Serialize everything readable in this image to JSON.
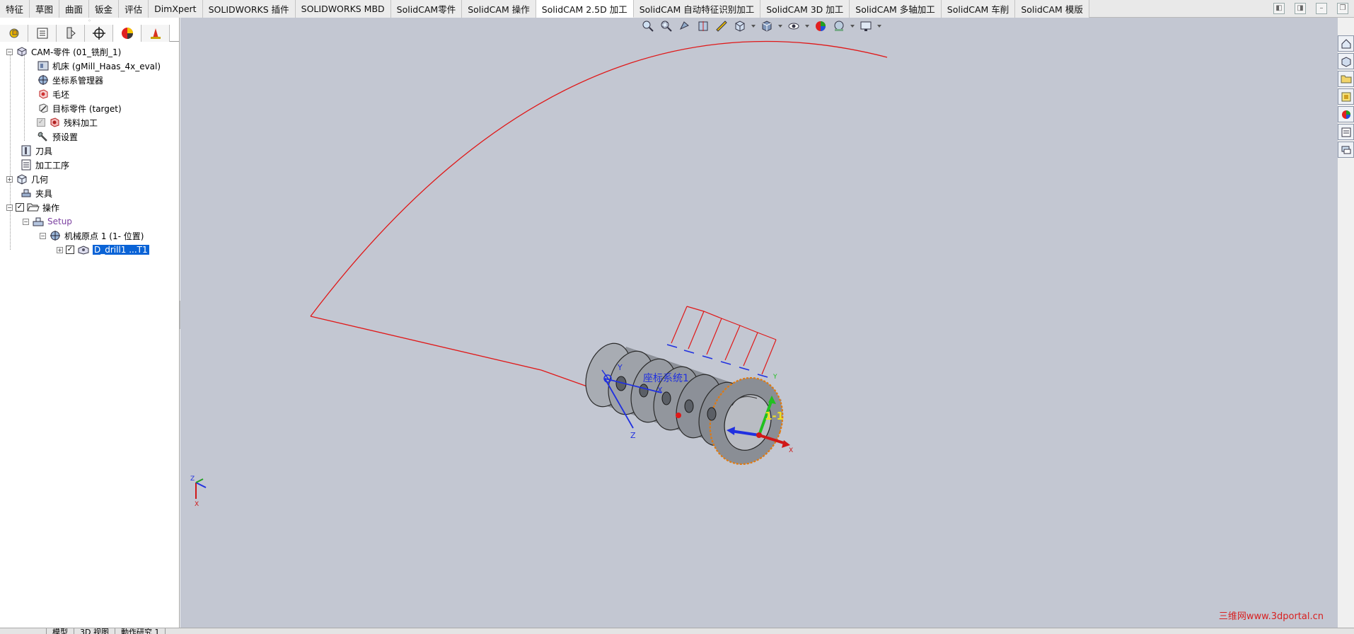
{
  "tabs": [
    "特征",
    "草图",
    "曲面",
    "钣金",
    "评估",
    "DimXpert",
    "SOLIDWORKS 插件",
    "SOLIDWORKS MBD",
    "SolidCAM零件",
    "SolidCAM 操作",
    "SolidCAM 2.5D 加工",
    "SolidCAM 自动特征识别加工",
    "SolidCAM 3D 加工",
    "SolidCAM 多轴加工",
    "SolidCAM 车削",
    "SolidCAM 模版"
  ],
  "active_tab_index": 10,
  "panel_tabs": [
    "feature-manager-icon",
    "property-manager-icon",
    "configuration-manager-icon",
    "dimxpert-icon",
    "display-manager-icon",
    "solidcam-manager-icon"
  ],
  "tree": {
    "root": "CAM-零件 (01_铣削_1)",
    "machine": "机床 (gMill_Haas_4x_eval)",
    "coord_manager": "坐标系管理器",
    "stock": "毛坯",
    "target": "目标零件 (target)",
    "rest": "残料加工",
    "presets": "预设置",
    "tools": "刀具",
    "process": "加工工序",
    "geometry": "几何",
    "fixture": "夹具",
    "operations": "操作",
    "setup": "Setup",
    "machine_origin": "机械原点 1 (1- 位置)",
    "operation_item": "D_drill1 ...T1"
  },
  "viewport": {
    "coord_label": "座标系统1",
    "axis_x": "X",
    "axis_y": "Y",
    "axis_z": "Z",
    "origin_label": "1-1",
    "triad_x": "X",
    "triad_y": "Y",
    "triad_z": "Z"
  },
  "bottom_tabs": [
    "",
    "模型",
    "3D 视图",
    "動作研究 1"
  ],
  "watermark": "三维网www.3dportal.cn",
  "colors": {
    "viewport_bg": "#c3c7d2",
    "toolpath": "#e01818",
    "coord_blue": "#2030e0",
    "selection": "#0a63d6"
  }
}
